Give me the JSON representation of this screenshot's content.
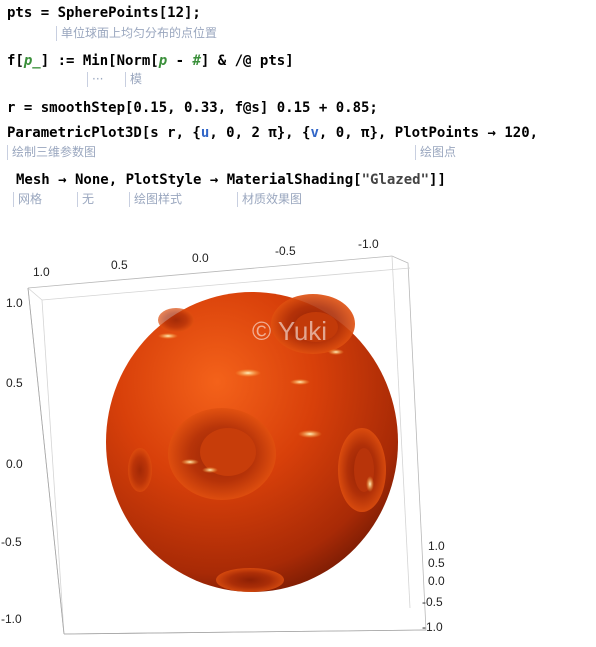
{
  "code": {
    "line1": {
      "a": "pts = SpherePoints[12];"
    },
    "line2": {
      "a": "f[",
      "b": "p_",
      "c": "] := Min[Norm[",
      "d": "p",
      "e": " - ",
      "f": "#",
      "g": "] & /@ pts]"
    },
    "line3": {
      "a": "r = smoothStep[0.15, 0.33, f@s] 0.15 + 0.85;"
    },
    "line4": {
      "a": "ParametricPlot3D[s r, {",
      "b": "u",
      "c": ", 0, 2 π}, {",
      "d": "v",
      "e": ", 0, π}, PlotPoints → 120,"
    },
    "line5": {
      "a": "Mesh → None, PlotStyle → MaterialShading[",
      "b": "\"Glazed\"",
      "c": "]]"
    }
  },
  "annotations": {
    "note1": "单位球面上均匀分布的点位置",
    "note2a": "···",
    "note2b": "模",
    "note4a": "绘制三维参数图",
    "note4b": "绘图点",
    "note5a": "网格",
    "note5b": "无",
    "note5c": "绘图样式",
    "note5d": "材质效果图"
  },
  "plot": {
    "watermark": "© Yuki",
    "sphere_color": "#d43a08",
    "top_ticks": [
      "1.0",
      "0.5",
      "0.0",
      "-0.5",
      "-1.0"
    ],
    "left_ticks": [
      "1.0",
      "0.5",
      "0.0",
      "-0.5",
      "-1.0"
    ],
    "right_ticks": [
      "1.0",
      "0.5",
      "0.0",
      "-0.5",
      "-1.0"
    ]
  }
}
